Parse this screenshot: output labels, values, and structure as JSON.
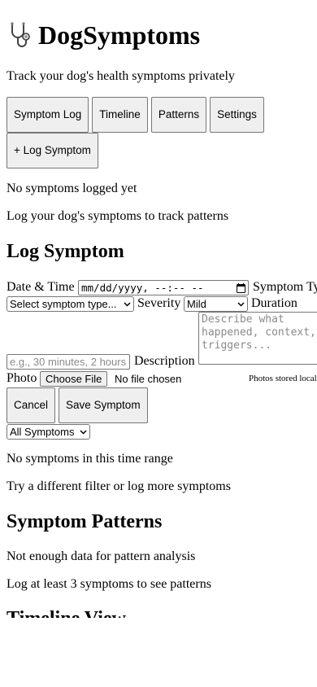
{
  "app": {
    "title": "DogSymptoms",
    "tagline": "Track your dog's health symptoms privately"
  },
  "nav": {
    "symptom_log": "Symptom Log",
    "timeline": "Timeline",
    "patterns": "Patterns",
    "settings": "Settings",
    "log_symptom": "+ Log Symptom"
  },
  "symptom_log": {
    "empty_title": "No symptoms logged yet",
    "empty_hint": "Log your dog's symptoms to track patterns"
  },
  "form": {
    "heading": "Log Symptom",
    "date_time_label": "Date & Time",
    "date_time_placeholder": "mm/dd/yyyy, --:-- --",
    "symptom_type_label": "Symptom Type",
    "symptom_type_selected": "Select symptom type...",
    "severity_label": "Severity",
    "severity_selected": "Mild",
    "duration_label": "Duration",
    "duration_placeholder": "e.g., 30 minutes, 2 hours",
    "description_label": "Description",
    "description_placeholder": "Describe what\nhappened, context,\ntriggers...",
    "photo_label": "Photo",
    "choose_file": "Choose File",
    "no_file": "No file chosen",
    "photo_note": "Photos stored locally",
    "cancel": "Cancel",
    "save": "Save Symptom"
  },
  "timeline": {
    "filter_selected": "All Symptoms",
    "empty_title": "No symptoms in this time range",
    "empty_hint": "Try a different filter or log more symptoms"
  },
  "patterns": {
    "heading": "Symptom Patterns",
    "empty_title": "Not enough data for pattern analysis",
    "empty_hint": "Log at least 3 symptoms to see patterns"
  },
  "timeline_view": {
    "heading": "Timeline View"
  },
  "icons": {
    "app_icon": "stethoscope-icon",
    "calendar": "calendar-icon",
    "select_arrow": "chevron-down-icon"
  }
}
